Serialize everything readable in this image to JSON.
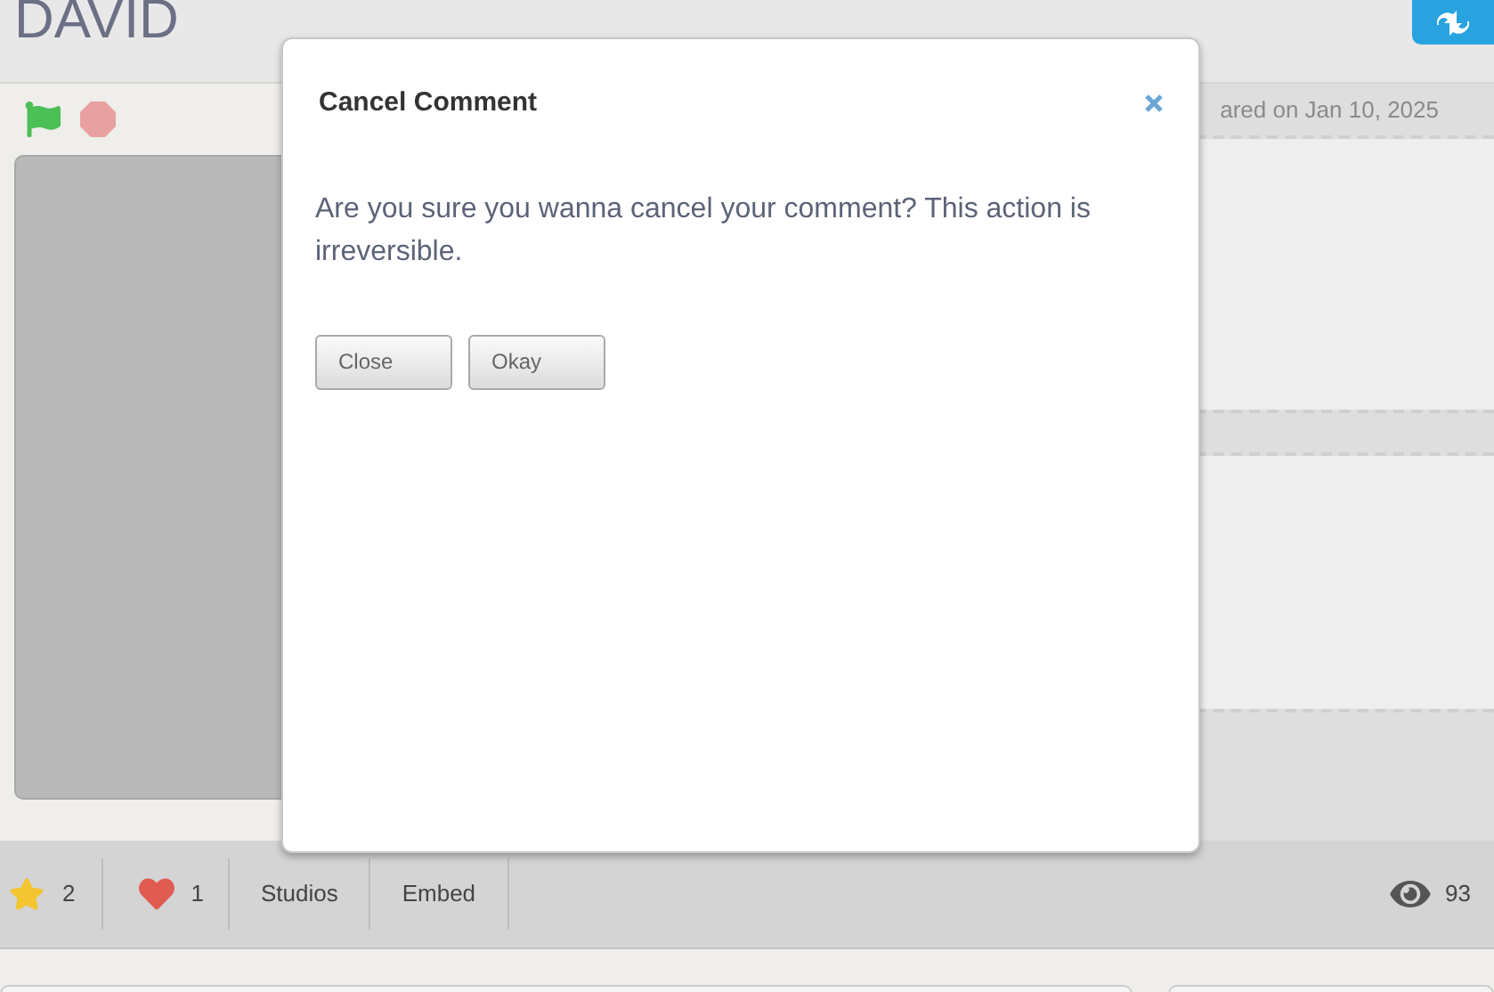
{
  "project": {
    "title": "DAVID",
    "shared_date": "ared on Jan 10, 2025"
  },
  "stats": {
    "stars": "2",
    "loves": "1",
    "studios": "Studios",
    "embed": "Embed",
    "views": "93"
  },
  "dialog": {
    "title": "Cancel Comment",
    "message": "Are you sure you wanna cancel your comment? This action is irreversible.",
    "buttons": [
      "Close",
      "Okay"
    ]
  }
}
